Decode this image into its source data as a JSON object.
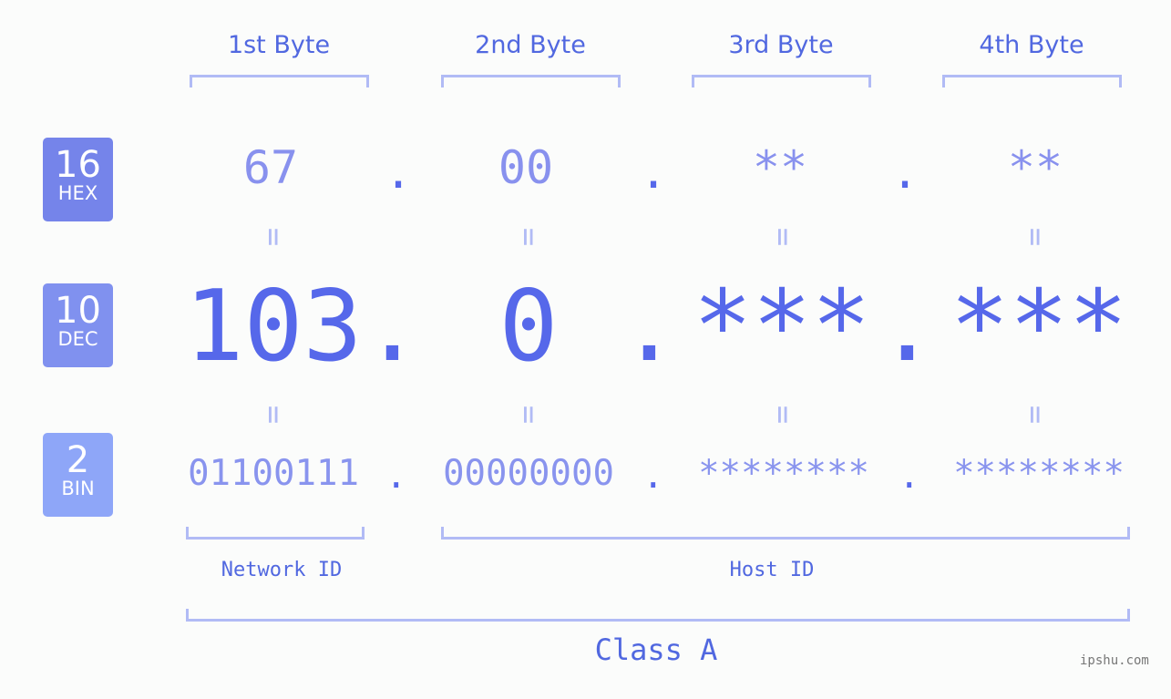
{
  "headers": [
    "1st Byte",
    "2nd Byte",
    "3rd Byte",
    "4th Byte"
  ],
  "badges": {
    "hex": {
      "num": "16",
      "label": "HEX",
      "color": "#7584ea"
    },
    "dec": {
      "num": "10",
      "label": "DEC",
      "color": "#8091ef"
    },
    "bin": {
      "num": "2",
      "label": "BIN",
      "color": "#8ea6f8"
    }
  },
  "hex": [
    "67",
    "00",
    "**",
    "**"
  ],
  "dec": [
    "103",
    "0",
    "***",
    "***"
  ],
  "bin": [
    "01100111",
    "00000000",
    "********",
    "********"
  ],
  "separator": ".",
  "equals": "=",
  "network_id": "Network ID",
  "host_id": "Host ID",
  "class": "Class A",
  "watermark": "ipshu.com",
  "colors": {
    "accent": "#5668ea",
    "light": "#b1bbf5",
    "muted": "#8891ee"
  }
}
